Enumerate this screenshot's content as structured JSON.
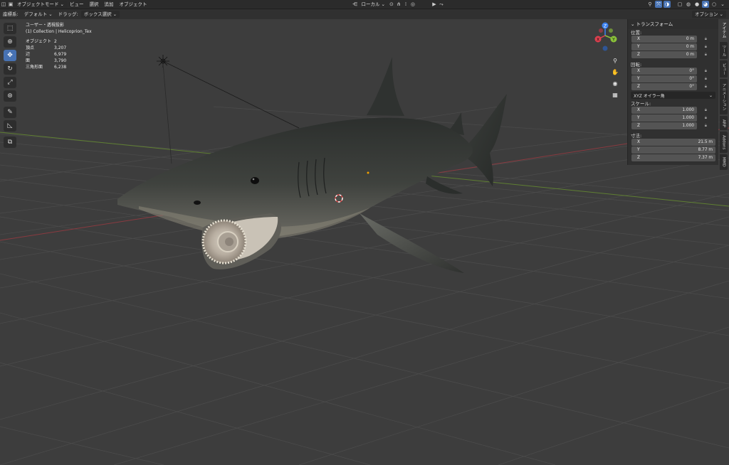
{
  "header": {
    "mode": "オブジェクトモード",
    "menus": [
      "ビュー",
      "選択",
      "追加",
      "オブジェクト"
    ],
    "orientation": "ローカル",
    "options_label": "オプション"
  },
  "subheader": {
    "coord_label": "座標系:",
    "coord_value": "デフォルト",
    "drag_label": "ドラッグ:",
    "drag_value": "ボックス選択"
  },
  "stats": {
    "view": "ユーザー・透視投影",
    "collection": "(1) Collection | Helicoprion_Tex",
    "rows": [
      {
        "label": "オブジェクト",
        "value": "2"
      },
      {
        "label": "頂点",
        "value": "3,207"
      },
      {
        "label": "辺",
        "value": "6,979"
      },
      {
        "label": "面",
        "value": "3,790"
      },
      {
        "label": "三角形面",
        "value": "6,238"
      }
    ]
  },
  "gizmo": {
    "x": "X",
    "y": "Y",
    "z": "Z"
  },
  "npanel": {
    "title": "トランスフォーム",
    "location_label": "位置:",
    "location": [
      {
        "axis": "X",
        "value": "0 m"
      },
      {
        "axis": "Y",
        "value": "0 m"
      },
      {
        "axis": "Z",
        "value": "0 m"
      }
    ],
    "rotation_label": "回転:",
    "rotation": [
      {
        "axis": "X",
        "value": "0°"
      },
      {
        "axis": "Y",
        "value": "0°"
      },
      {
        "axis": "Z",
        "value": "0°"
      }
    ],
    "rotation_mode": "XYZ オイラー角",
    "scale_label": "スケール:",
    "scale": [
      {
        "axis": "X",
        "value": "1.000"
      },
      {
        "axis": "Y",
        "value": "1.000"
      },
      {
        "axis": "Z",
        "value": "1.000"
      }
    ],
    "dimensions_label": "寸法:",
    "dimensions": [
      {
        "axis": "X",
        "value": "21.5 m"
      },
      {
        "axis": "Y",
        "value": "8.77 m"
      },
      {
        "axis": "Z",
        "value": "7.37 m"
      }
    ]
  },
  "side_tabs": [
    "アイテム",
    "ツール",
    "ビュー",
    "アニメーション",
    "ARP",
    "Addons",
    "MMD"
  ],
  "colors": {
    "accent": "#4772b3",
    "x_axis": "#e0404f",
    "y_axis": "#8bc33a",
    "z_axis": "#3d82f0",
    "viewport_bg": "#3d3d3d"
  }
}
